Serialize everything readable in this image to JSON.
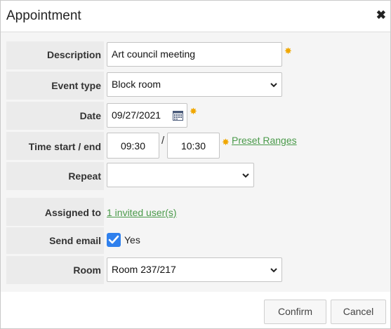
{
  "dialog": {
    "title": "Appointment",
    "close_icon": "close-icon"
  },
  "form": {
    "description": {
      "label": "Description",
      "value": "Art council meeting",
      "required": true
    },
    "event_type": {
      "label": "Event type",
      "value": "Block room"
    },
    "date": {
      "label": "Date",
      "value": "09/27/2021",
      "required": true,
      "icon": "calendar-icon"
    },
    "time": {
      "label": "Time start / end",
      "start": "09:30",
      "separator": "/",
      "end": "10:30",
      "preset_link": "Preset Ranges",
      "required": true
    },
    "repeat": {
      "label": "Repeat",
      "value": ""
    },
    "assigned_to": {
      "label": "Assigned to",
      "link": "1 invited user(s)"
    },
    "send_email": {
      "label": "Send email",
      "checked": true,
      "option": "Yes"
    },
    "room": {
      "label": "Room",
      "value": "Room 237/217"
    }
  },
  "footer": {
    "confirm_label": "Confirm",
    "cancel_label": "Cancel"
  },
  "colors": {
    "required_star": "#f0a700",
    "link": "#4a9a4a",
    "checkbox": "#2f80ed"
  }
}
